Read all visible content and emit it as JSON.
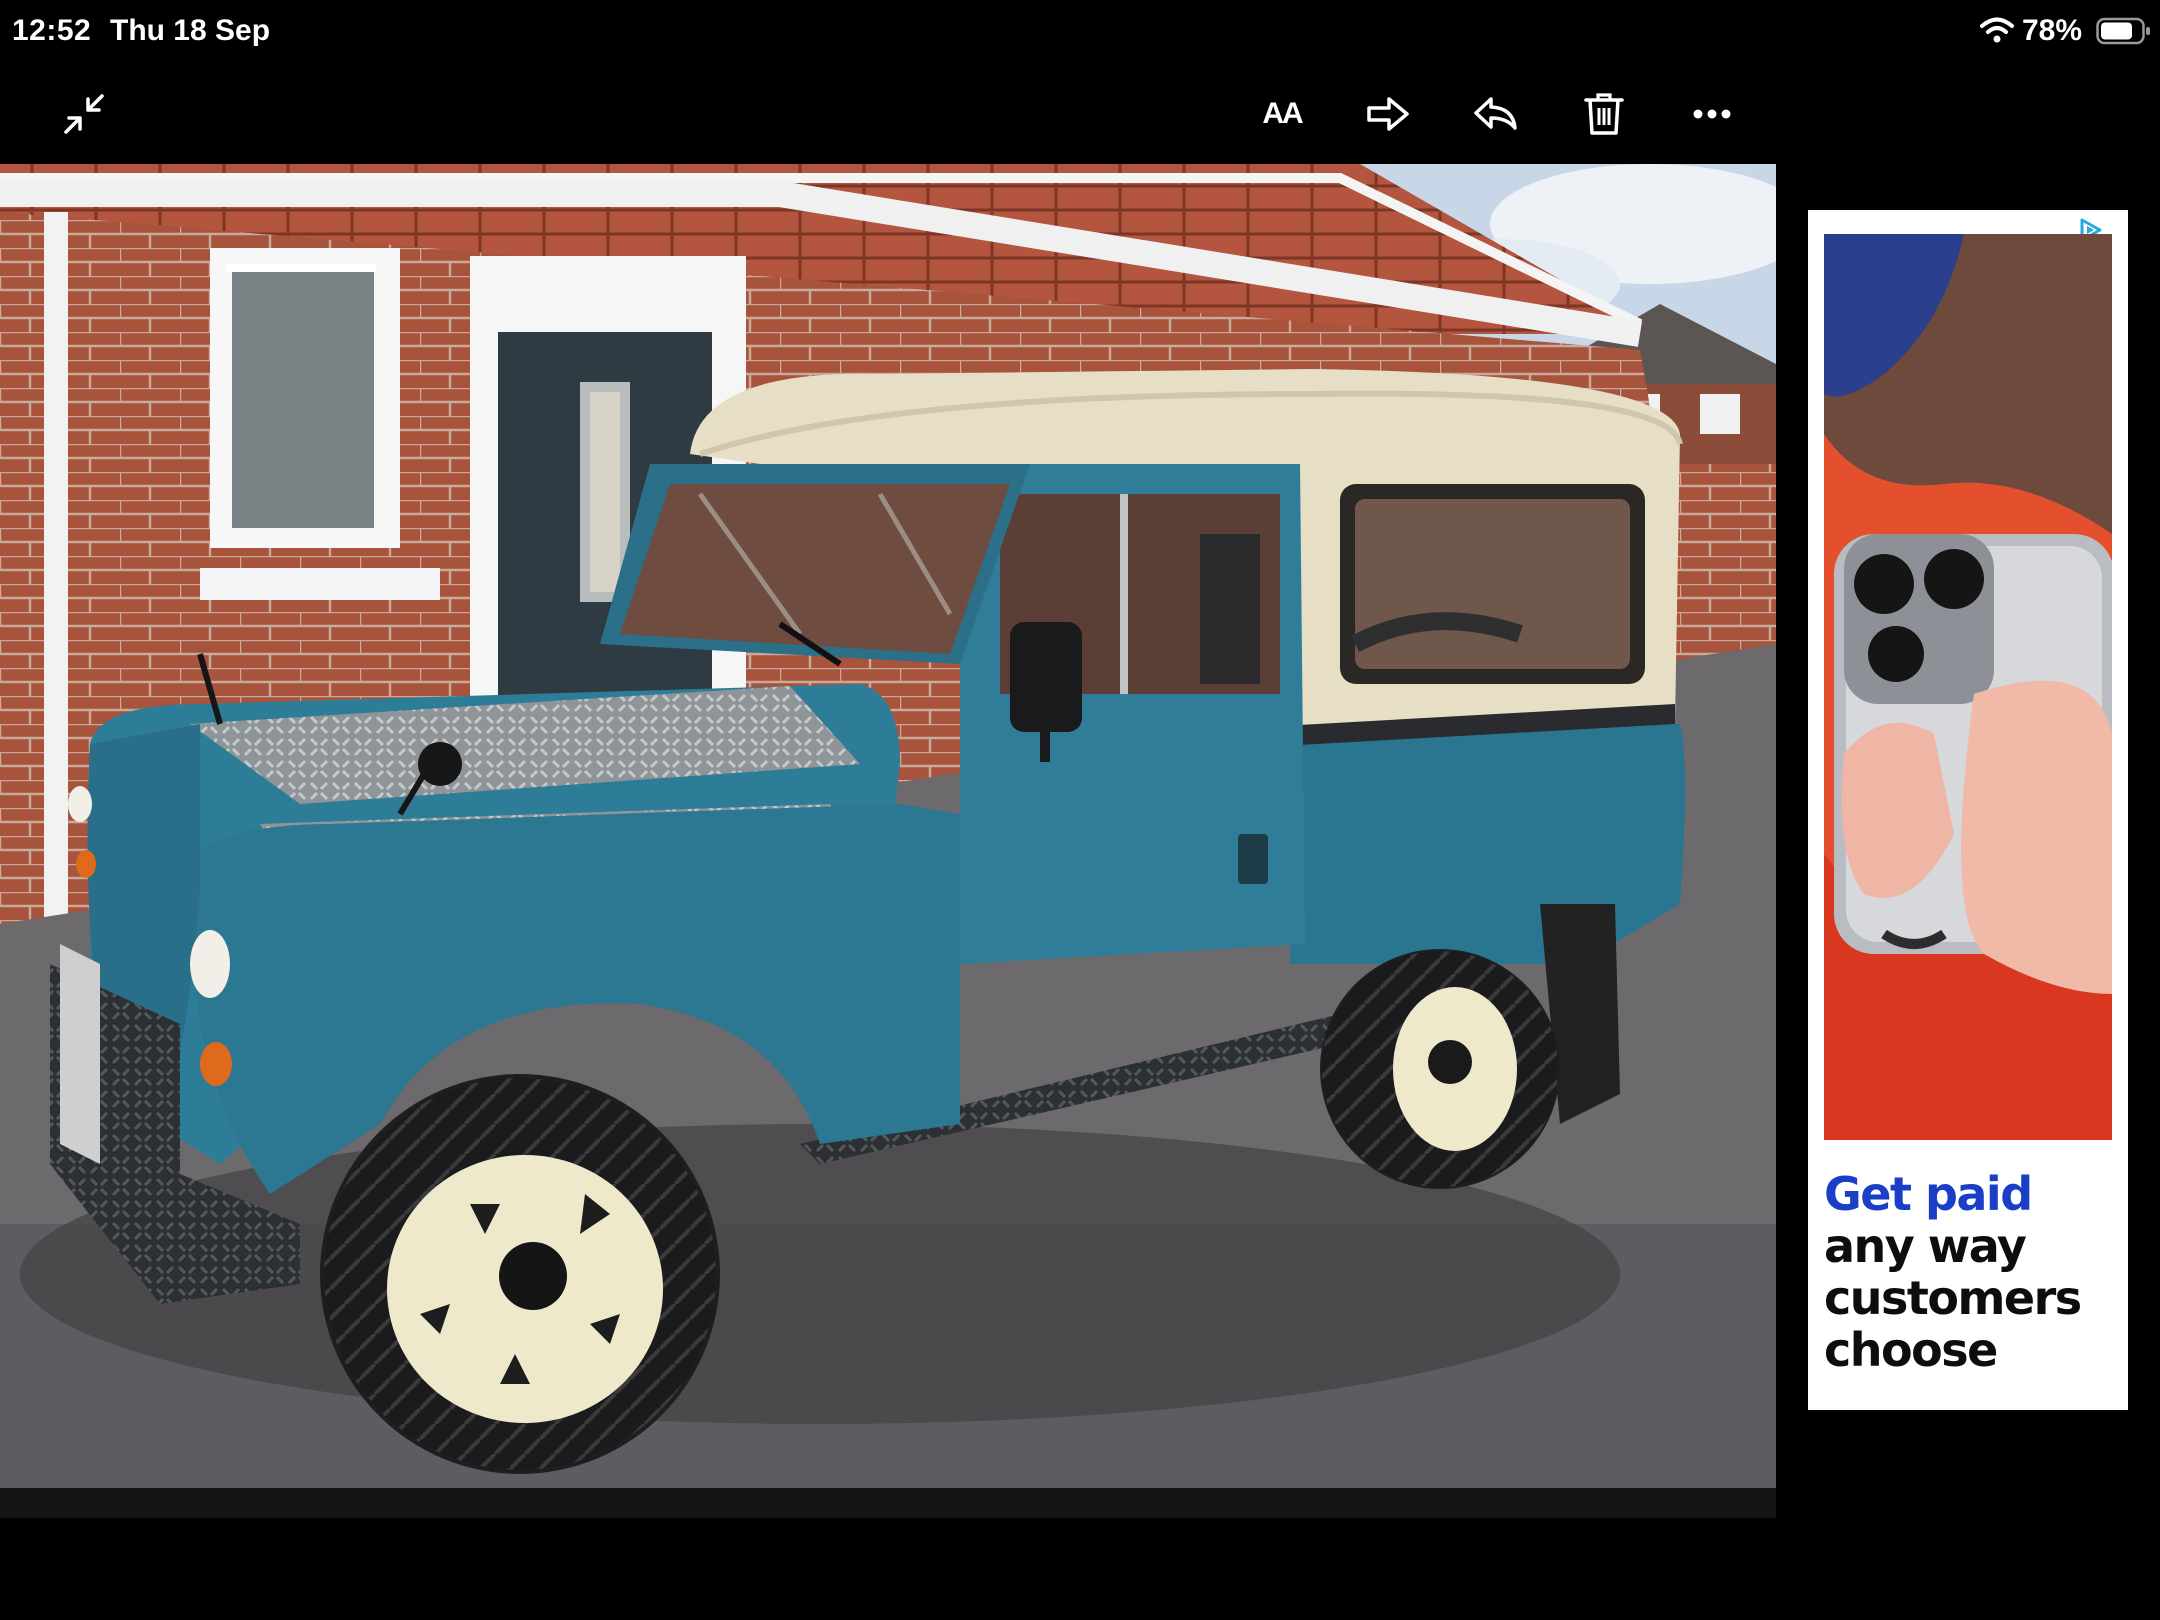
{
  "status_bar": {
    "time": "12:52",
    "date": "Thu 18 Sep",
    "battery": "78%"
  },
  "toolbar": {
    "buttons": [
      {
        "name": "collapse-icon"
      },
      {
        "name": "text-size-icon",
        "label": "AA"
      },
      {
        "name": "forward-icon"
      },
      {
        "name": "reply-icon"
      },
      {
        "name": "trash-icon"
      },
      {
        "name": "more-icon"
      }
    ]
  },
  "ad": {
    "headline_line1": "Get paid",
    "headline_line2": "any way customers choose",
    "colors": {
      "accent": "#1a3ec6",
      "text": "#0d0d0d"
    }
  }
}
